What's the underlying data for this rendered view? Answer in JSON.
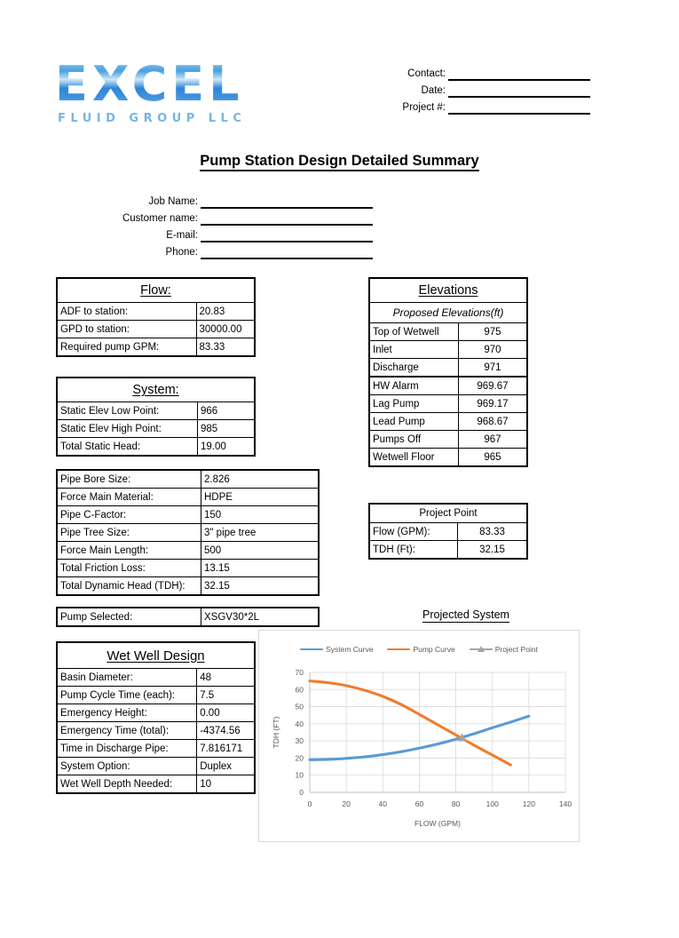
{
  "logo": {
    "word": "EXCEL",
    "subtitle": "FLUID GROUP LLC"
  },
  "header_fields": [
    {
      "label": "Contact:",
      "value": ""
    },
    {
      "label": "Date:",
      "value": ""
    },
    {
      "label": "Project #:",
      "value": ""
    }
  ],
  "title": "Pump Station Design Detailed Summary",
  "job_fields": [
    {
      "label": "Job Name:",
      "value": ""
    },
    {
      "label": "Customer name:",
      "value": ""
    },
    {
      "label": "E-mail:",
      "value": ""
    },
    {
      "label": "Phone:",
      "value": ""
    }
  ],
  "flow": {
    "title": "Flow:",
    "rows": [
      {
        "label": "ADF to station:",
        "value": "20.83"
      },
      {
        "label": "GPD to station:",
        "value": "30000.00"
      },
      {
        "label": "Required pump GPM:",
        "value": "83.33"
      }
    ]
  },
  "system": {
    "title": "System:",
    "rows": [
      {
        "label": "Static Elev Low Point:",
        "value": "966"
      },
      {
        "label": "Static Elev High Point:",
        "value": "985"
      },
      {
        "label": "Total Static Head:",
        "value": "19.00"
      }
    ]
  },
  "pipe": {
    "rows": [
      {
        "label": "Pipe Bore Size:",
        "value": "2.826",
        "wide": false
      },
      {
        "label": "Force Main Material:",
        "value": "HDPE",
        "wide": true
      },
      {
        "label": "Pipe C-Factor:",
        "value": "150",
        "wide": false
      },
      {
        "label": "Pipe Tree Size:",
        "value": "3\" pipe tree",
        "wide": true
      },
      {
        "label": "Force Main Length:",
        "value": "500",
        "wide": false
      },
      {
        "label": "Total Friction Loss:",
        "value": "13.15",
        "wide": false
      },
      {
        "label": "Total Dynamic Head (TDH):",
        "value": "32.15",
        "wide": false
      }
    ]
  },
  "pump_selected": {
    "label": "Pump Selected:",
    "value": "XSGV30*2L"
  },
  "wet_well": {
    "title": "Wet Well Design",
    "rows": [
      {
        "label": "Basin Diameter:",
        "value": "48"
      },
      {
        "label": "Pump Cycle Time (each):",
        "value": "7.5"
      },
      {
        "label": "Emergency Height:",
        "value": "0.00"
      },
      {
        "label": "Emergency Time (total):",
        "value": "-4374.56"
      },
      {
        "label": "Time in Discharge Pipe:",
        "value": "7.816171"
      },
      {
        "label": "System Option:",
        "value": "Duplex"
      },
      {
        "label": "Wet Well Depth Needed:",
        "value": "10"
      }
    ]
  },
  "elevations": {
    "title": "Elevations",
    "subtitle": "Proposed Elevations(ft)",
    "rows": [
      {
        "label": "Top of Wetwell",
        "value": "975"
      },
      {
        "label": "Inlet",
        "value": "970"
      },
      {
        "label": "Discharge",
        "value": "971"
      },
      {
        "label": "HW Alarm",
        "value": "969.67"
      },
      {
        "label": "Lag Pump",
        "value": "969.17"
      },
      {
        "label": "Lead Pump",
        "value": "968.67"
      },
      {
        "label": "Pumps Off",
        "value": "967"
      },
      {
        "label": "Wetwell Floor",
        "value": "965"
      }
    ]
  },
  "project_point": {
    "title": "Project Point",
    "rows": [
      {
        "label": "Flow (GPM):",
        "value": "83.33"
      },
      {
        "label": "TDH (Ft):",
        "value": "32.15"
      }
    ]
  },
  "projected_system_label": "Projected System",
  "chart_data": {
    "type": "line",
    "title": "",
    "xlabel": "FLOW (GPM)",
    "ylabel": "TDH (FT)",
    "xlim": [
      0,
      140
    ],
    "ylim": [
      0,
      70
    ],
    "xticks": [
      0,
      20,
      40,
      60,
      80,
      100,
      120,
      140
    ],
    "yticks": [
      0,
      10,
      20,
      30,
      40,
      50,
      60,
      70
    ],
    "grid": true,
    "legend_position": "top",
    "colors": {
      "system_curve": "#5B9BD5",
      "pump_curve": "#ED7D31",
      "project_point": "#A5A5A5"
    },
    "series": [
      {
        "name": "System Curve",
        "color": "#5B9BD5",
        "x": [
          0,
          10,
          20,
          30,
          40,
          50,
          60,
          70,
          80,
          90,
          100,
          110,
          120
        ],
        "y": [
          19.0,
          19.2,
          19.8,
          20.7,
          22.0,
          23.7,
          25.8,
          28.2,
          31.0,
          34.2,
          37.7,
          41.0,
          44.5
        ]
      },
      {
        "name": "Pump Curve",
        "color": "#ED7D31",
        "x": [
          0,
          10,
          20,
          30,
          40,
          50,
          60,
          70,
          80,
          90,
          100,
          110
        ],
        "y": [
          65.0,
          64.0,
          62.3,
          59.6,
          56.0,
          51.3,
          45.5,
          39.5,
          33.5,
          27.5,
          21.8,
          16.0
        ]
      },
      {
        "name": "Project Point",
        "color": "#A5A5A5",
        "marker": "triangle",
        "x": [
          83.33
        ],
        "y": [
          32.15
        ]
      }
    ]
  }
}
